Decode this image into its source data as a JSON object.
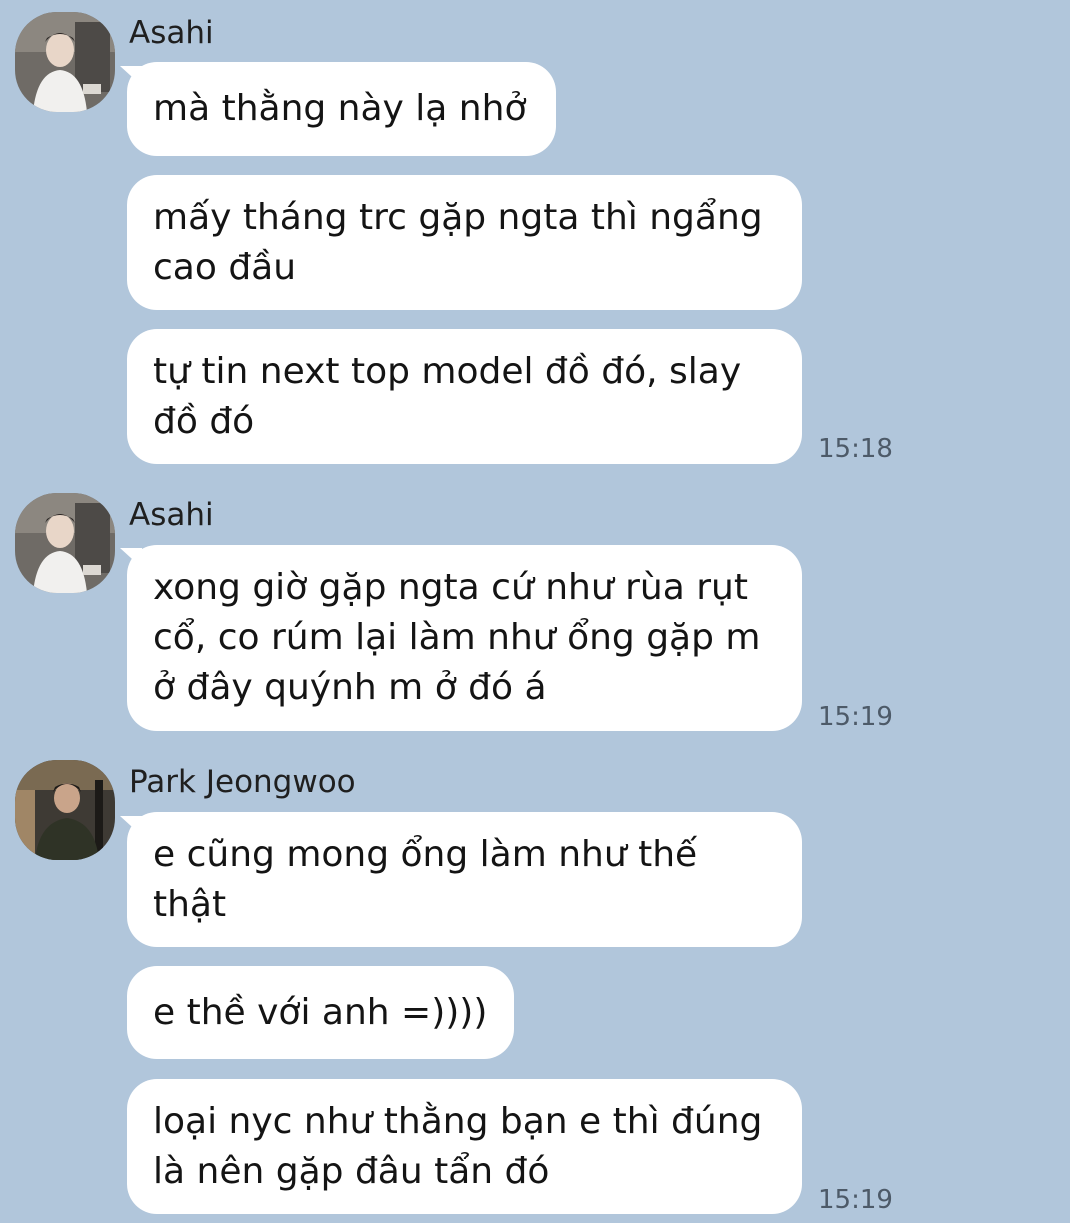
{
  "colors": {
    "background": "#b1c6db",
    "bubble": "#ffffff",
    "text": "#141414",
    "timestamp": "#4d5a68"
  },
  "groups": [
    {
      "sender": "Asahi",
      "avatar": "asahi-avatar",
      "messages": [
        "mà thằng này lạ nhở",
        "mấy tháng trc gặp ngta thì ngẩng cao đầu",
        "tự tin next top model đồ đó, slay đồ đó"
      ],
      "time": "15:18"
    },
    {
      "sender": "Asahi",
      "avatar": "asahi-avatar",
      "messages": [
        "xong giờ gặp ngta cứ như rùa rụt cổ, co rúm lại làm như ổng gặp m ở đây quýnh m ở đó á"
      ],
      "time": "15:19"
    },
    {
      "sender": "Park Jeongwoo",
      "avatar": "jeongwoo-avatar",
      "messages": [
        "e cũng mong ổng làm như thế thật",
        "e thề với anh =))))",
        "loại nyc như thằng bạn e thì đúng là nên gặp đâu tẩn đó"
      ],
      "time": "15:19"
    }
  ]
}
